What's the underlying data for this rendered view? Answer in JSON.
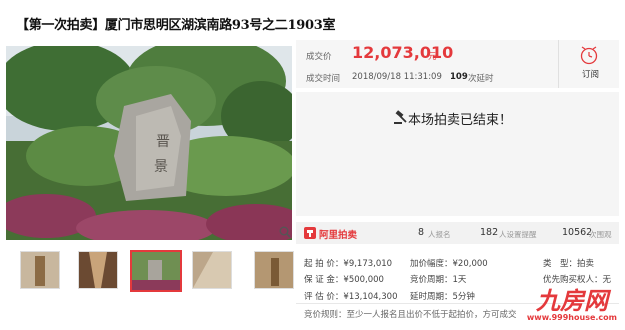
{
  "title": "【第一次拍卖】厦门市思明区湖滨南路93号之二1903室",
  "price": {
    "label": "成交价",
    "value": "12,073,010",
    "unit": "元"
  },
  "deal_time": {
    "label": "成交时间",
    "value": "2018/09/18 11:31:09",
    "delay_count": "109",
    "delay_suffix": "次延时"
  },
  "subscribe": {
    "label": "订阅",
    "icon": "alarm-clock-icon"
  },
  "auction_status": {
    "text": "本场拍卖已结束！",
    "icon": "gavel-icon"
  },
  "stats": {
    "brand": "阿里拍卖",
    "signups": "8",
    "signups_label": "人报名",
    "reminders": "182",
    "reminders_label": "人设置提醒",
    "views": "10562",
    "views_label": "次围观"
  },
  "details": {
    "start_price_label": "起 拍 价：",
    "start_price": "¥9,173,010",
    "deposit_label": "保 证 金：",
    "deposit": "¥500,000",
    "appraisal_label": "评 估 价：",
    "appraisal": "¥13,104,300",
    "increment_label": "加价幅度：",
    "increment": "¥20,000",
    "cycle_label": "竞价周期：",
    "cycle": "1天",
    "delay_label": "延时周期：",
    "delay": "5分钟",
    "type_label": "类　型：",
    "type": "拍卖",
    "priority_label": "优先购买权人：",
    "priority": "无",
    "rule_label": "竞价规则：",
    "rule": "至少一人报名且出价不低于起拍价，方可成交"
  },
  "watermark": {
    "logo": "九房网",
    "url": "www.999house.com"
  },
  "colors": {
    "accent": "#e4393c",
    "panel": "#f5f5f5"
  }
}
